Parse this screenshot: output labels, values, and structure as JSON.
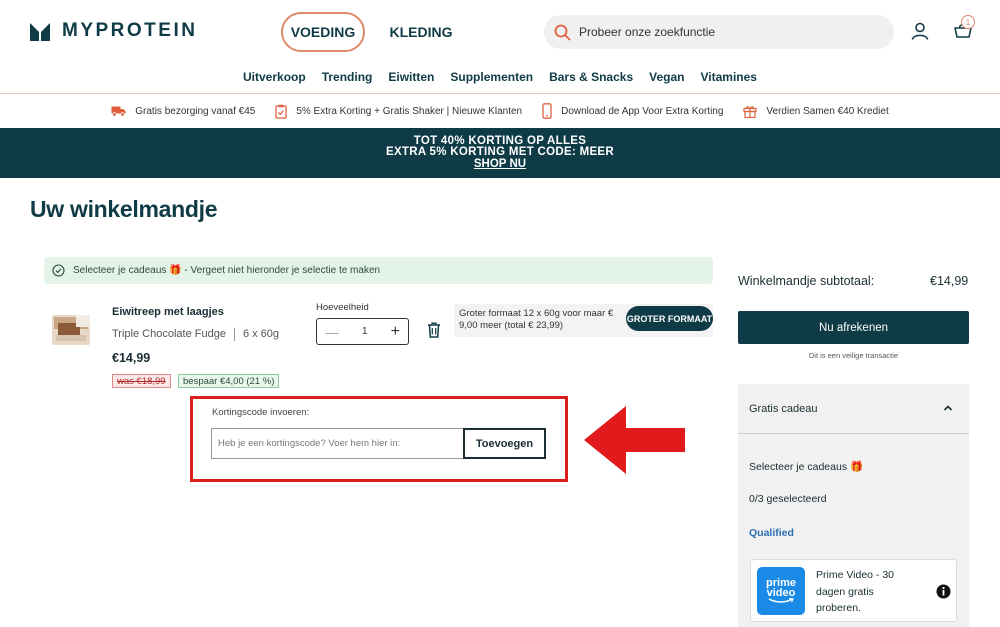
{
  "brand": {
    "name": "MYPROTEIN"
  },
  "header": {
    "tabs": [
      "VOEDING",
      "KLEDING"
    ],
    "search_placeholder": "Probeer onze zoekfunctie",
    "basket_count": "1"
  },
  "nav": {
    "items": [
      "Uitverkoop",
      "Trending",
      "Eiwitten",
      "Supplementen",
      "Bars & Snacks",
      "Vegan",
      "Vitamines"
    ]
  },
  "usp": {
    "items": [
      {
        "icon": "truck-icon",
        "text": "Gratis bezorging vanaf €45"
      },
      {
        "icon": "clipboard-check-icon",
        "text": "5% Extra Korting + Gratis Shaker | Nieuwe Klanten"
      },
      {
        "icon": "phone-icon",
        "text": "Download de App Voor Extra Korting"
      },
      {
        "icon": "gift-icon",
        "text": "Verdien Samen €40 Krediet"
      }
    ]
  },
  "promo": {
    "line1": "TOT 40% KORTING OP ALLES",
    "line2": "EXTRA 5% KORTING MET CODE: MEER",
    "link": "SHOP NU"
  },
  "page": {
    "title": "Uw winkelmandje"
  },
  "gift_notice": {
    "text": "Selecteer je cadeaus 🎁 - Vergeet niet hieronder je selectie te maken"
  },
  "product": {
    "name": "Eiwitreep met laagjes",
    "flavour": "Triple Chocolate Fudge",
    "size": "6 x 60g",
    "price": "€14,99",
    "was": "was €18,99",
    "saving": "bespaar €4,00 (21 %)",
    "quantity_label": "Hoeveelheid",
    "quantity": "1",
    "upsell_text": "Groter formaat 12 x 60g voor maar € 9,00 meer (total € 23,99)",
    "upsell_button": "GROTER FORMAAT"
  },
  "coupon": {
    "label": "Kortingscode invoeren:",
    "placeholder": "Heb je een kortingscode? Voer hem hier in:",
    "button": "Toevoegen"
  },
  "summary": {
    "subtotal_label": "Winkelmandje subtotaal:",
    "subtotal_value": "€14,99",
    "checkout_button": "Nu afrekenen",
    "secure_note": "Dit is een veilige transactie"
  },
  "gift_panel": {
    "title": "Gratis cadeau",
    "select_text": "Selecteer je cadeaus 🎁",
    "count_text": "0/3 geselecteerd",
    "qualified": "Qualified",
    "offer_logo_line1": "prime",
    "offer_logo_line2": "video",
    "offer_text": "Prime Video - 30 dagen gratis proberen."
  },
  "colors": {
    "primary": "#0f3b47",
    "accent": "#e08a6b",
    "highlight_red": "#d91c1c",
    "success_bg": "#e3f3e8"
  }
}
